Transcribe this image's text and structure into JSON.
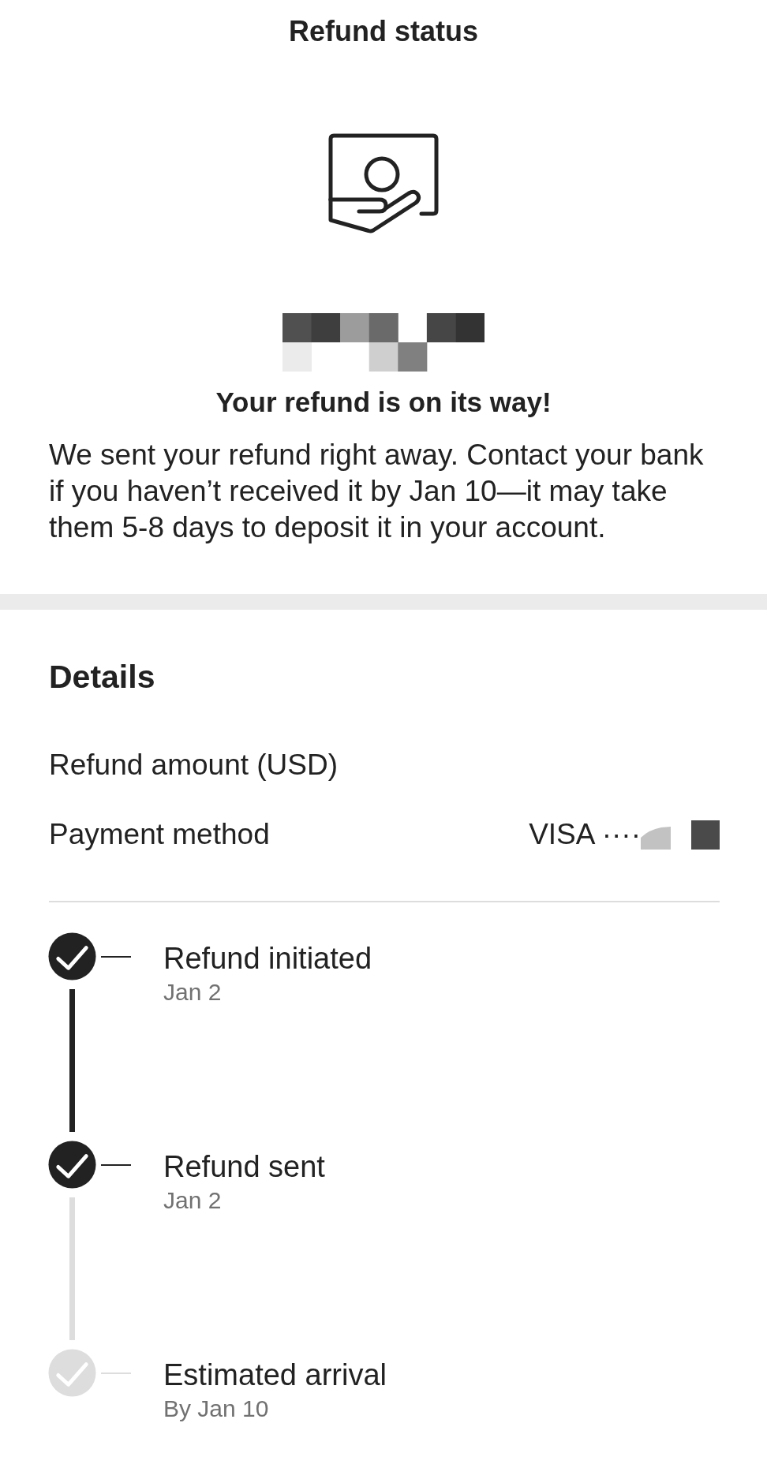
{
  "header": {
    "title": "Refund status"
  },
  "hero": {
    "heading": "Your refund is on its way!",
    "message": "We sent your refund right away. Contact your bank if you haven’t received it by Jan 10—it may take them 5-8 days to deposit it in your account."
  },
  "details": {
    "title": "Details",
    "rows": [
      {
        "label": "Refund amount (USD)"
      },
      {
        "label": "Payment method",
        "value": "VISA ····"
      }
    ]
  },
  "timeline": [
    {
      "title": "Refund initiated",
      "date": "Jan 2",
      "done": true
    },
    {
      "title": "Refund sent",
      "date": "Jan 2",
      "done": true
    },
    {
      "title": "Estimated arrival",
      "date": "By Jan 10",
      "done": false
    }
  ]
}
